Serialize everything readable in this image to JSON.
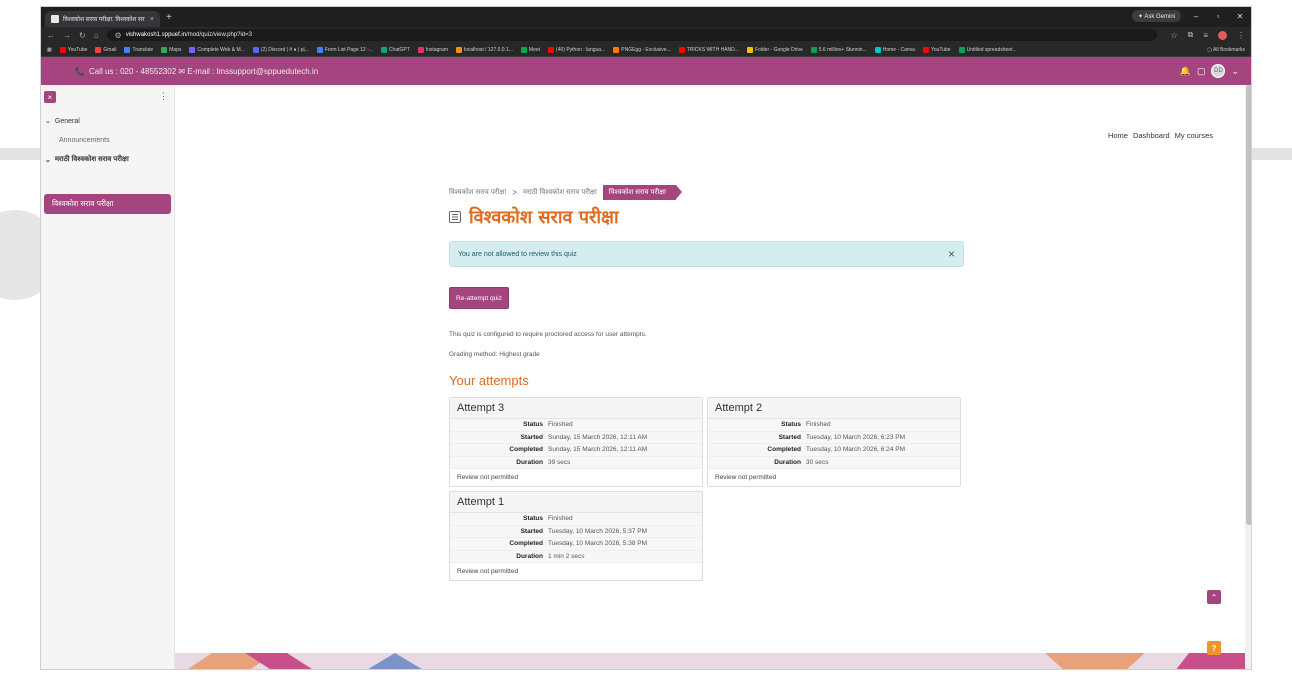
{
  "browser": {
    "tab_title": "विश्वकोश सराव परीक्षा: विश्वकोश सर",
    "tab_close": "×",
    "new_tab": "+",
    "gemini_label": "✦ Ask Gemini",
    "url_domain": "vishwakosh1.sppuef.in",
    "url_path": "/mod/quiz/view.php?id=3",
    "all_bookmarks": "All Bookmarks",
    "bookmarks": [
      {
        "label": "YouTube",
        "color": "#ff0000"
      },
      {
        "label": "Gmail",
        "color": "#ea4335"
      },
      {
        "label": "Translate",
        "color": "#4285f4"
      },
      {
        "label": "Maps",
        "color": "#34a853"
      },
      {
        "label": "Complete Web & M...",
        "color": "#7b61ff"
      },
      {
        "label": "(2) Discord | # ● | p|...",
        "color": "#5865f2"
      },
      {
        "label": "Form List Page 12 -...",
        "color": "#3b82f6"
      },
      {
        "label": "ChatGPT",
        "color": "#10a37f"
      },
      {
        "label": "Instagram",
        "color": "#e1306c"
      },
      {
        "label": "localhost / 127.0.0.1...",
        "color": "#f29111"
      },
      {
        "label": "Meet",
        "color": "#00ac47"
      },
      {
        "label": "(40) Python : langua...",
        "color": "#ff0000"
      },
      {
        "label": "PNGEgg - Exclusive...",
        "color": "#ff7a00"
      },
      {
        "label": "TRICKS WITH HAND...",
        "color": "#ff0000"
      },
      {
        "label": "Folder - Google Drive",
        "color": "#fbbc04"
      },
      {
        "label": "5.6 million+ Stunnin...",
        "color": "#0f9d58"
      },
      {
        "label": "Home - Canva",
        "color": "#00c4cc"
      },
      {
        "label": "YouTube",
        "color": "#ff0000"
      },
      {
        "label": "Untitled spreadsheet...",
        "color": "#0f9d58"
      }
    ]
  },
  "header": {
    "contact": "Call us : 020 - 48552302  ✉ E-mail : lmssupport@sppuedutech.in",
    "avatar_initials": "DD"
  },
  "sidebar": {
    "close_icon": "×",
    "menu_icon": "⋮",
    "general_label": "General",
    "announcements_label": "Announcements",
    "section2_label": "मराठी विश्वकोश सराव परीक्षा",
    "active_item_label": "विश्वकोश सराव परीक्षा"
  },
  "topnav": {
    "home": "Home",
    "dashboard": "Dashboard",
    "my_courses": "My courses"
  },
  "breadcrumb": {
    "items": [
      "विश्वकोश सराव परीक्षा",
      "मराठी विश्वकोश सराव परीक्षा"
    ],
    "current": "विश्वकोश सराव परीक्षा",
    "separator": ">"
  },
  "page": {
    "title": "विश्वकोश सराव परीक्षा",
    "alert_text": "You are not allowed to review this quiz",
    "alert_close": "×",
    "reattempt_label": "Re-attempt quiz",
    "info_proctored": "This quiz is configured to require proctored access for user attempts.",
    "info_grading": "Grading method: Highest grade",
    "attempts_heading": "Your attempts"
  },
  "labels": {
    "status": "Status",
    "started": "Started",
    "completed": "Completed",
    "duration": "Duration"
  },
  "attempts": [
    {
      "title": "Attempt 3",
      "status": "Finished",
      "started": "Sunday, 15 March 2026, 12:11 AM",
      "completed": "Sunday, 15 March 2026, 12:11 AM",
      "duration": "39 secs",
      "review": "Review not permitted"
    },
    {
      "title": "Attempt 2",
      "status": "Finished",
      "started": "Tuesday, 10 March 2026, 6:23 PM",
      "completed": "Tuesday, 10 March 2026, 6:24 PM",
      "duration": "30 secs",
      "review": "Review not permitted"
    },
    {
      "title": "Attempt 1",
      "status": "Finished",
      "started": "Tuesday, 10 March 2026, 5:37 PM",
      "completed": "Tuesday, 10 March 2026, 5:38 PM",
      "duration": "1 min 2 secs",
      "review": "Review not permitted"
    }
  ],
  "floating": {
    "scroll_top_icon": "⌃",
    "help_icon": "?"
  },
  "colors": {
    "brand": "#a5457f",
    "accent_orange": "#e06b1c",
    "alert_bg": "#d4eef0"
  }
}
